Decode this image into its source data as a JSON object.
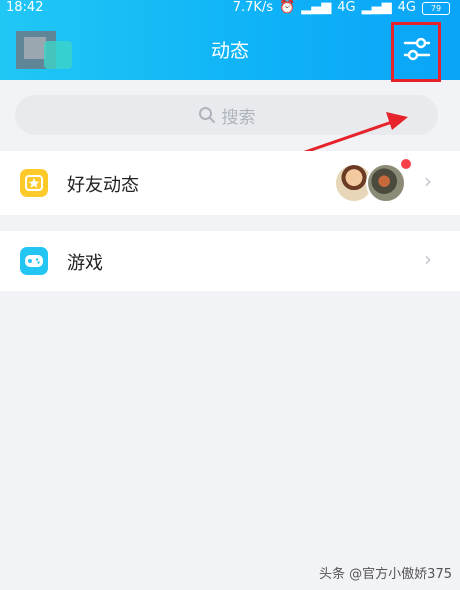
{
  "status_bar": {
    "time": "18:42",
    "network_speed": "7.7K/s",
    "signal_1": "4G",
    "signal_2": "4G",
    "battery": "79"
  },
  "header": {
    "title": "动态",
    "filter_icon": "sliders-icon"
  },
  "search": {
    "placeholder": "搜索",
    "icon": "search-icon"
  },
  "list": {
    "items": [
      {
        "label": "好友动态",
        "icon": "star-icon",
        "has_new": true
      },
      {
        "label": "游戏",
        "icon": "gamepad-icon"
      }
    ]
  },
  "watermark": {
    "text": "头条 @官方小傲娇375"
  },
  "colors": {
    "header_start": "#21c7f5",
    "header_end": "#0aa4f8",
    "annotation_red": "#e6222a",
    "friends_icon_bg": "#fdc92b",
    "games_icon_bg": "#23c6f2",
    "badge_red": "#f5404a"
  }
}
